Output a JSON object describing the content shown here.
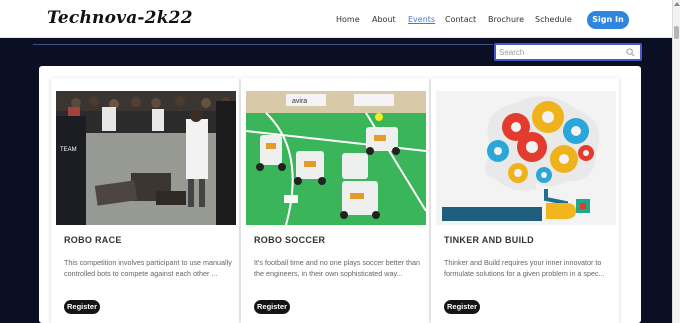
{
  "header": {
    "logo": "Technova-2k22",
    "nav": [
      {
        "label": "Home"
      },
      {
        "label": "About"
      },
      {
        "label": "Events",
        "active": true
      },
      {
        "label": "Contact"
      },
      {
        "label": "Brochure"
      },
      {
        "label": "Schedule"
      }
    ],
    "signin_label": "Sign In"
  },
  "search": {
    "placeholder": "Search",
    "icon": "search-icon"
  },
  "events": [
    {
      "title": "ROBO RACE",
      "description": "This competition involves participant to use manually controlled bots to compete against each other ...",
      "register_label": "Register"
    },
    {
      "title": "ROBO SOCCER",
      "description": "It's football time and no one plays soccer better than the engineers, in their own sophisticated way...",
      "register_label": "Register"
    },
    {
      "title": "TINKER AND BUILD",
      "description": "Thinker and Build requires your inner innovator to formulate solutions for a given problem in a spec...",
      "register_label": "Register"
    }
  ],
  "colors": {
    "page_background": "#0b0f24",
    "signin_button": "#2e86de",
    "active_link": "#3a7bd5",
    "register_button": "#151515"
  }
}
